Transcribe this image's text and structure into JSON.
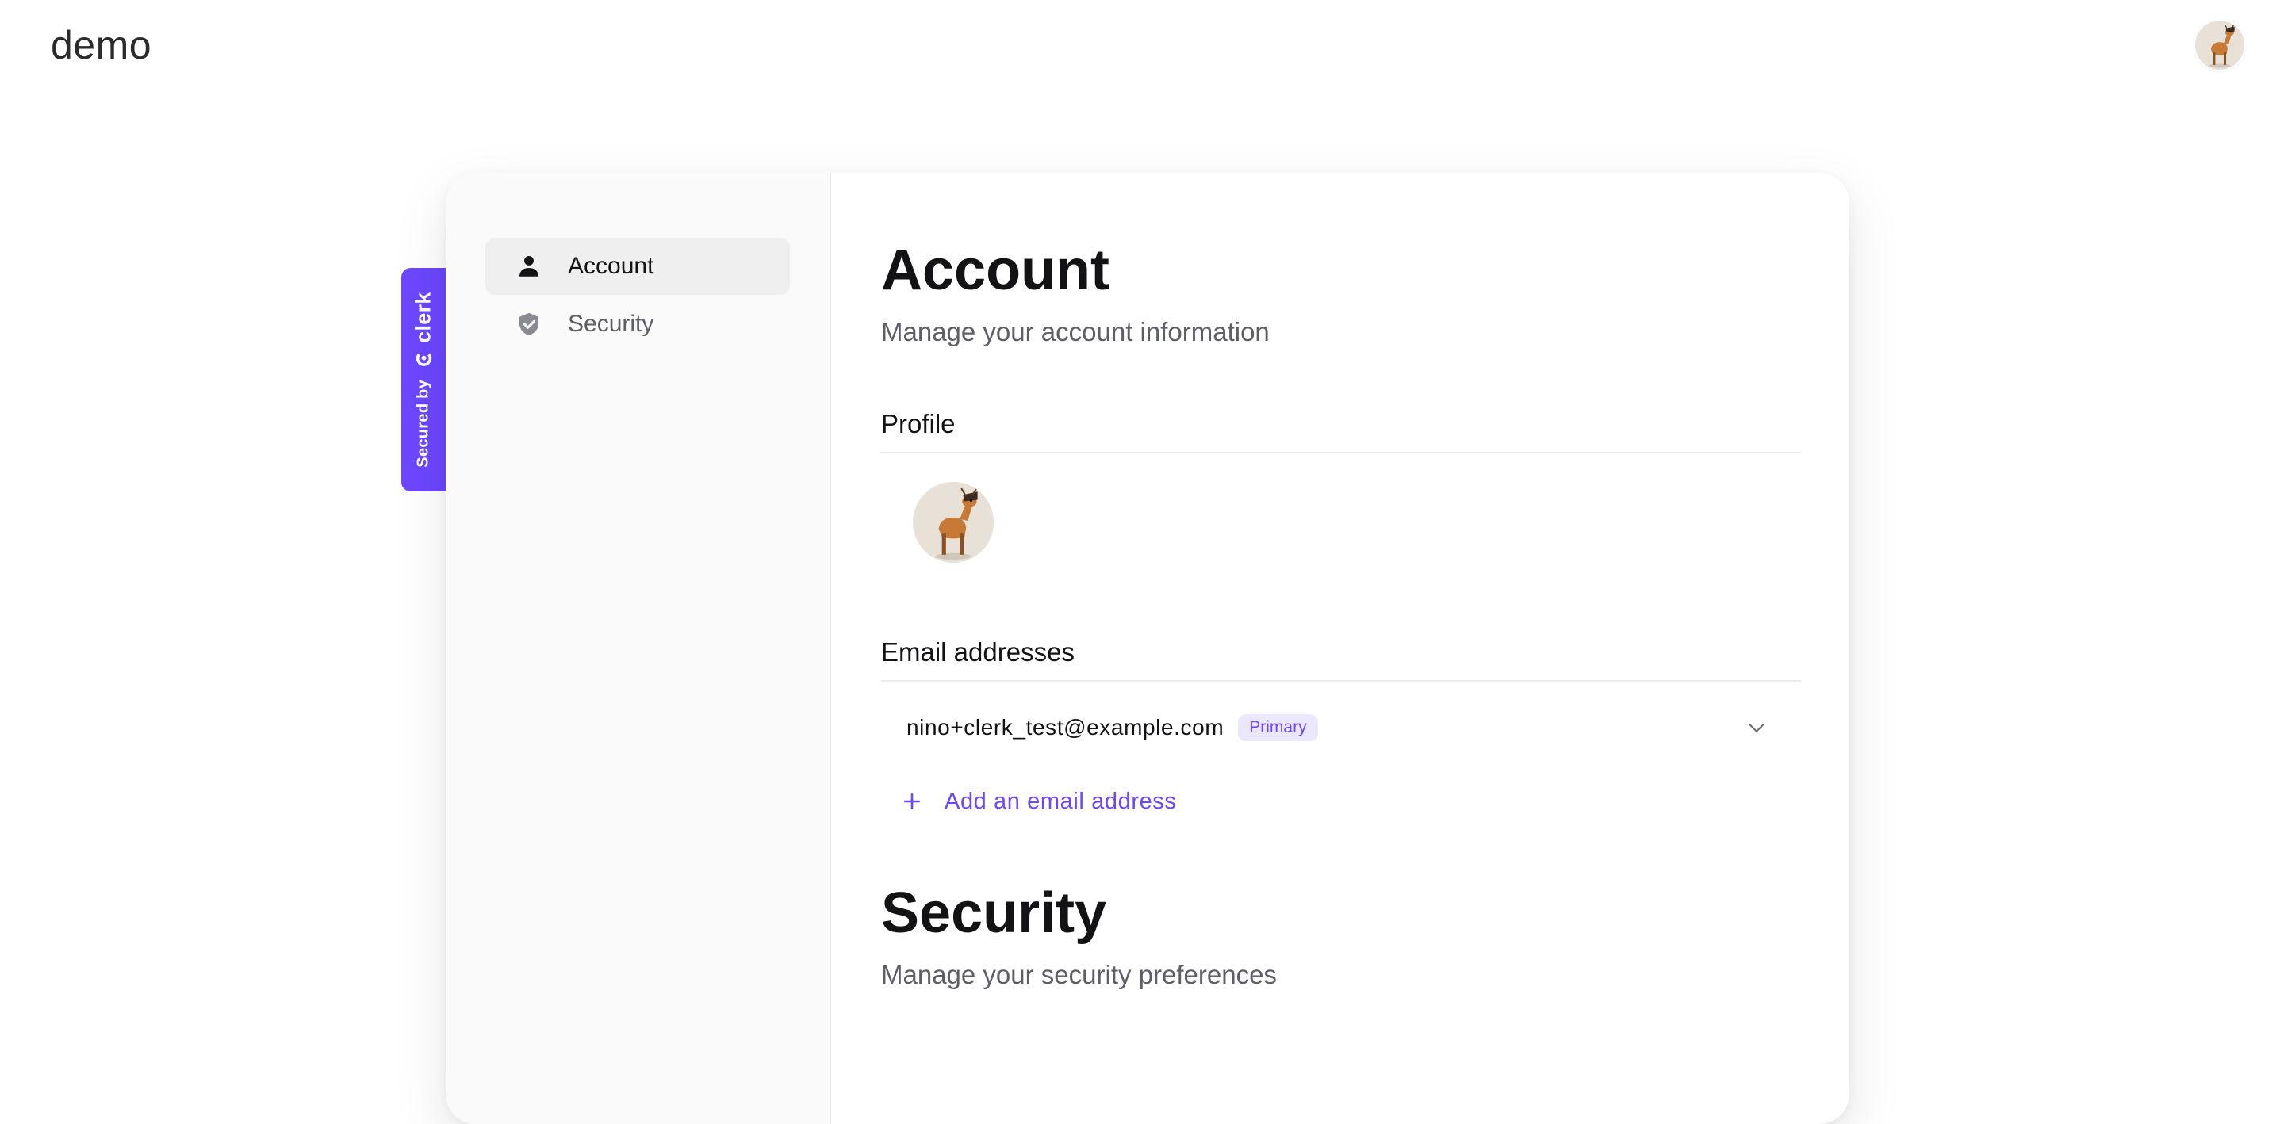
{
  "app": {
    "title": "demo"
  },
  "header": {
    "avatar_icon": "user-avatar-icon"
  },
  "badge": {
    "secured_by": "Secured by",
    "brand": "clerk",
    "color": "#6c47ff"
  },
  "sidebar": {
    "items": [
      {
        "label": "Account",
        "icon": "user-icon",
        "active": true
      },
      {
        "label": "Security",
        "icon": "shield-check-icon",
        "active": false
      }
    ]
  },
  "account": {
    "title": "Account",
    "subtitle": "Manage your account information",
    "profile": {
      "title": "Profile"
    },
    "emails": {
      "title": "Email addresses",
      "items": [
        {
          "address": "nino+clerk_test@example.com",
          "badge": "Primary"
        }
      ],
      "add_label": "Add an email address"
    }
  },
  "security": {
    "title": "Security",
    "subtitle": "Manage your security preferences"
  },
  "colors": {
    "accent": "#6c47ff",
    "muted": "#5e5e66",
    "text": "#131316"
  }
}
